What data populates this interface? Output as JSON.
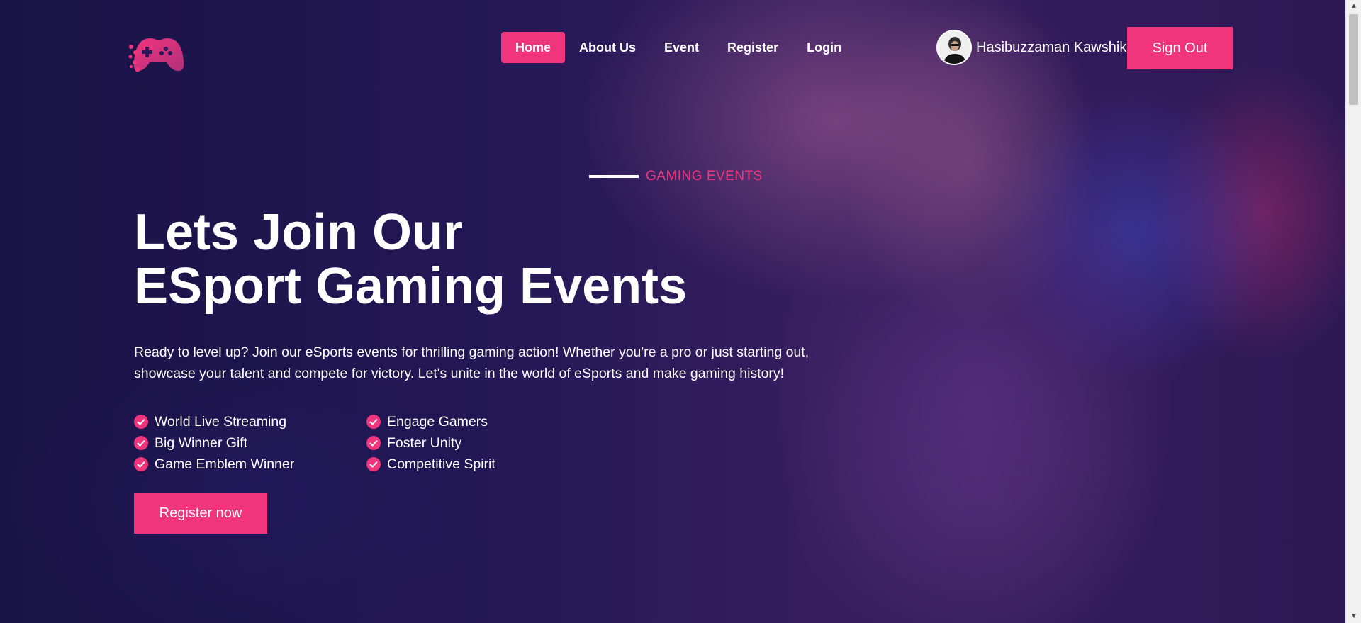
{
  "nav": {
    "items": [
      {
        "label": "Home",
        "active": true
      },
      {
        "label": "About Us",
        "active": false
      },
      {
        "label": "Event",
        "active": false
      },
      {
        "label": "Register",
        "active": false
      },
      {
        "label": "Login",
        "active": false
      }
    ]
  },
  "user": {
    "name": "Hasibuzzaman Kawshik",
    "sign_out_label": "Sign Out"
  },
  "hero": {
    "eyebrow": "GAMING EVENTS",
    "title_line1": "Lets Join Our",
    "title_line2": "ESport Gaming Events",
    "description": "Ready to level up? Join our eSports events for thrilling gaming action! Whether you're a pro or just starting out, showcase your talent and compete for victory. Let's unite in the world of eSports and make gaming history!",
    "features": [
      "World Live Streaming",
      "Engage Gamers",
      "Big Winner Gift",
      "Foster Unity",
      "Game Emblem Winner",
      "Competitive Spirit"
    ],
    "cta_label": "Register now"
  },
  "colors": {
    "accent": "#f0357d",
    "text": "#ffffff",
    "background": "#1c1447"
  },
  "icons": {
    "logo": "gamepad-logo",
    "feature": "check-circle-icon"
  }
}
